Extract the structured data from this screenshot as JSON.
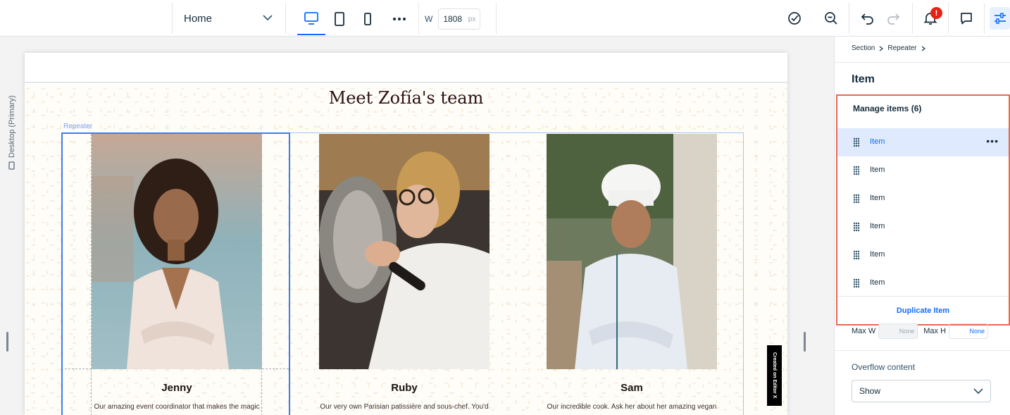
{
  "toolbar": {
    "page_select": "Home",
    "width_label": "W",
    "width_value": "1808",
    "width_unit": "px",
    "notification_badge": "!",
    "devices": [
      "desktop-icon",
      "tablet-icon",
      "mobile-icon",
      "more-icon"
    ],
    "right_icons": [
      "checkmark-icon",
      "zoom-out-icon",
      "undo-icon",
      "redo-icon",
      "bell-icon",
      "comment-icon",
      "settings-icon"
    ]
  },
  "canvas": {
    "breakpoint_label": "Desktop (Primary)",
    "section_title": "Meet Zofía's team",
    "repeater_label": "Repeater",
    "badge": "Created on Editor X",
    "team": [
      {
        "name": "Jenny",
        "bio": "Our amazing event coordinator that makes the magic"
      },
      {
        "name": "Ruby",
        "bio": "Our very own Parisian patissière and sous-chef. You'd"
      },
      {
        "name": "Sam",
        "bio": "Our incredible cook. Ask her about her amazing vegan"
      }
    ]
  },
  "panel": {
    "breadcrumb": [
      "Section",
      "Repeater"
    ],
    "title": "Item",
    "manage_title": "Manage items (6)",
    "items": [
      "Item",
      "Item",
      "Item",
      "Item",
      "Item",
      "Item"
    ],
    "duplicate_label": "Duplicate Item",
    "max_w_label": "Max W",
    "max_w_value": "None",
    "max_h_label": "Max H",
    "max_h_value": "None",
    "overflow_label": "Overflow content",
    "overflow_value": "Show"
  },
  "colors": {
    "accent": "#116dff",
    "highlight_border": "#e86a55",
    "selected_row": "#dfeafe",
    "badge_red": "#e62214"
  }
}
